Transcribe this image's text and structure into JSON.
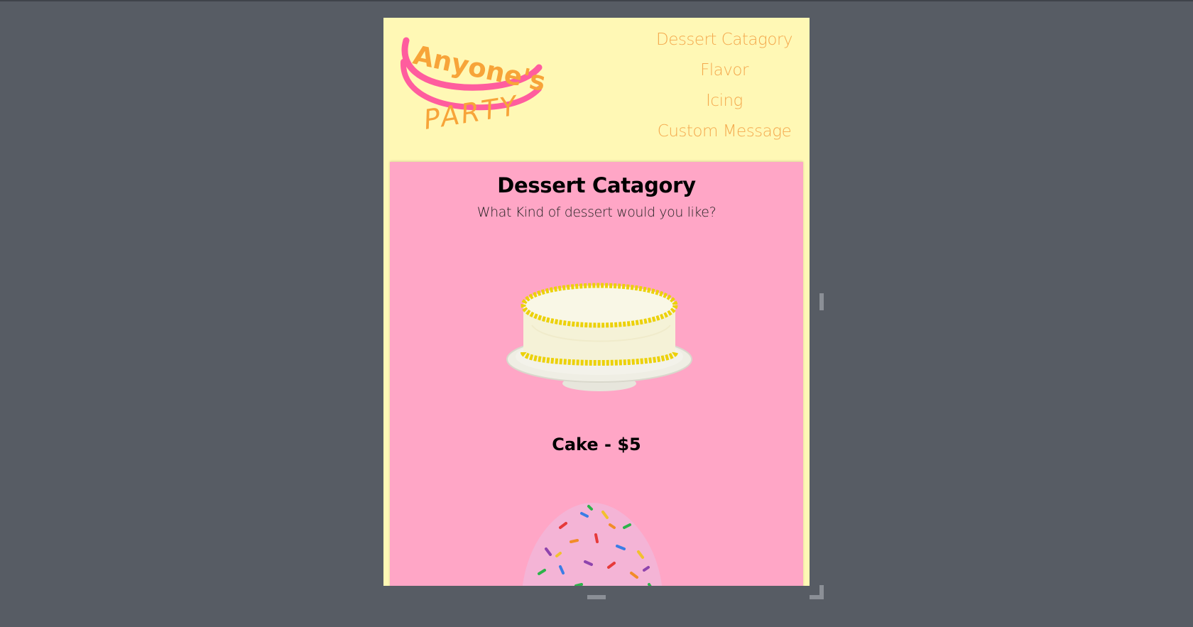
{
  "logo": {
    "line1": "Anyone's",
    "line2": "PARTY"
  },
  "nav": {
    "items": [
      {
        "label": "Dessert Catagory"
      },
      {
        "label": "Flavor"
      },
      {
        "label": "Icing"
      },
      {
        "label": "Custom Message"
      }
    ]
  },
  "main": {
    "title": "Dessert Catagory",
    "subtitle": "What Kind of dessert would you like?",
    "options": [
      {
        "label": "Cake - $5",
        "icon": "cake-image"
      },
      {
        "label": "",
        "icon": "cupcake-image"
      }
    ]
  },
  "colors": {
    "page_background": "#575c64",
    "panel_background": "#fff8b5",
    "content_background": "#ffa6c6",
    "nav_text": "#f4a94e",
    "logo_orange": "#f7a439",
    "logo_pink": "#ff5d9e"
  }
}
